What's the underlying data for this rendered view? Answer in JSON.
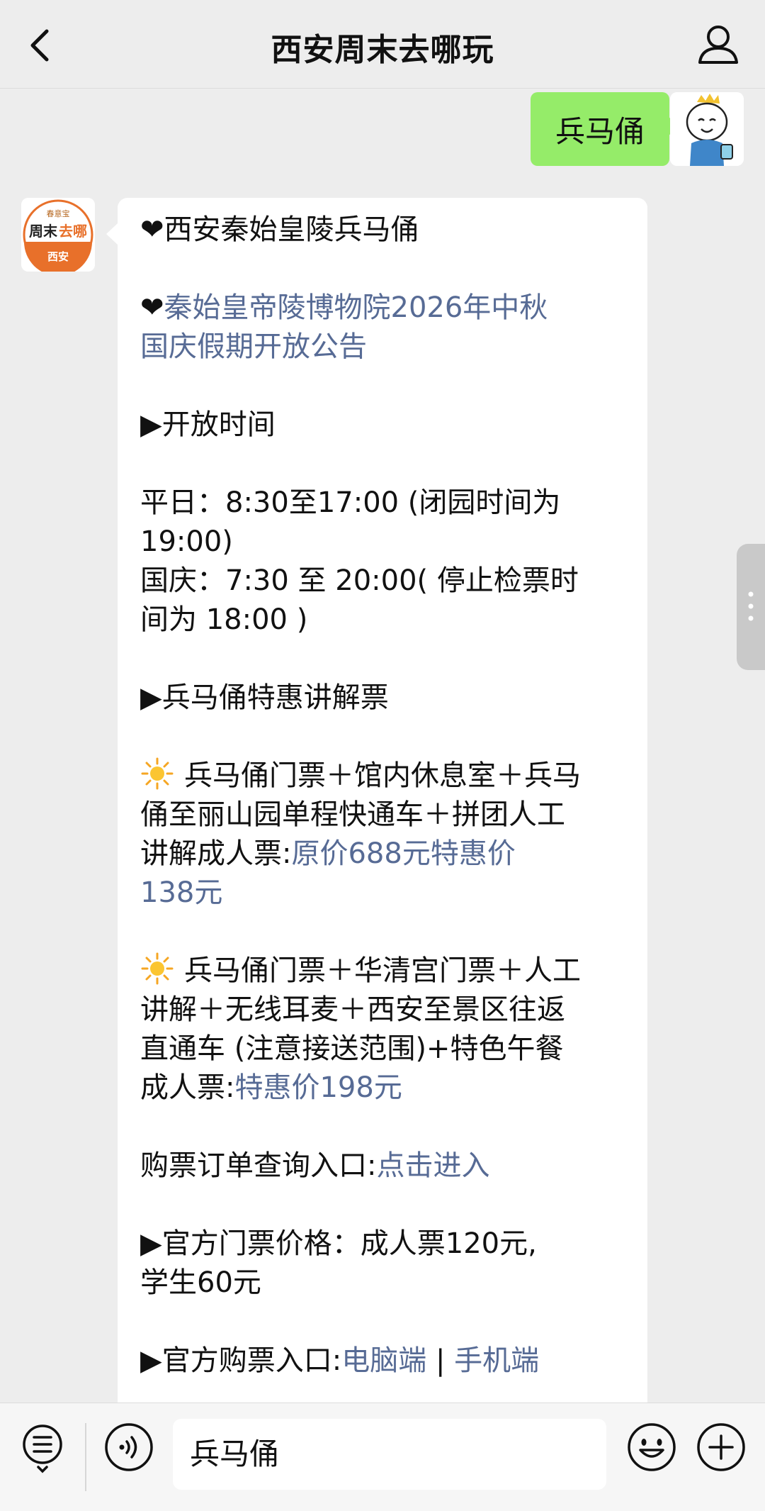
{
  "header": {
    "title": "西安周末去哪玩"
  },
  "outgoing": {
    "text": "兵马俑"
  },
  "bot_avatar": {
    "top_text": "春意宝",
    "line1": "周末",
    "line1_accent": "去哪",
    "bottom_text": "西安"
  },
  "message": {
    "l01": "❤西安秦始皇陵兵马俑",
    "l02_heart": "❤",
    "l02_link": "秦始皇帝陵博物院2026年中秋",
    "l03_link": "国庆假期开放公告",
    "l04": "▶开放时间",
    "l05": "平日：8:30至17:00 (闭园时间为",
    "l06": "19:00)",
    "l07": "国庆：7:30 至 20:00( 停止检票时",
    "l08": "间为 18:00 )",
    "l09": "▶兵马俑特惠讲解票",
    "l10": "兵马俑门票＋馆内休息室＋兵马",
    "l11": "俑至丽山园单程快通车＋拼团人工",
    "l12_text": "讲解成人票:",
    "l12_link": "原价688元特惠价",
    "l13_link": "138元",
    "l14": "兵马俑门票＋华清宫门票＋人工",
    "l15": "讲解＋无线耳麦＋西安至景区往返",
    "l16": "直通车 (注意接送范围)+特色午餐",
    "l17_text": "成人票:",
    "l17_link": "特惠价198元",
    "l18_text": "购票订单查询入口:",
    "l18_link": "点击进入",
    "l19": "▶官方门票价格：成人票120元,",
    "l20": "学生60元",
    "l21_text": "▶官方购票入口:",
    "l21_link1": "电脑端",
    "l21_sep": " | ",
    "l21_link2": "手机端"
  },
  "input": {
    "value": "兵马俑"
  },
  "icons": {
    "back": "chevron-left-icon",
    "user": "user-icon",
    "menu": "list-menu-icon",
    "voice": "voice-icon",
    "emoji": "emoji-icon",
    "plus": "plus-icon",
    "sun": "sun-icon"
  },
  "colors": {
    "bubble_out": "#95ec69",
    "link": "#576b95",
    "accent_orange": "#e8702a"
  }
}
